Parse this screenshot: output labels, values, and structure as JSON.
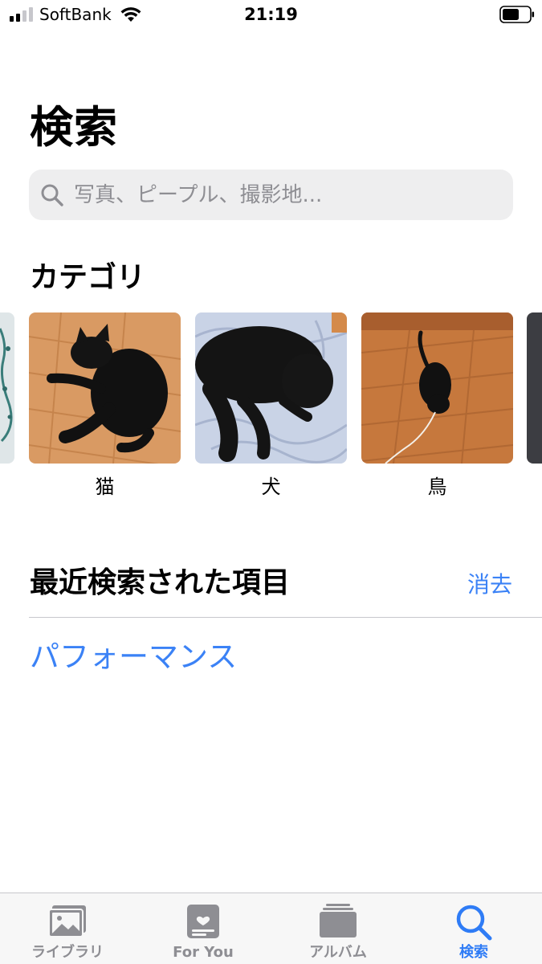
{
  "status_bar": {
    "carrier": "SoftBank",
    "time": "21:19",
    "signal_bars": 4,
    "signal_bars_filled": 2
  },
  "page": {
    "title": "検索",
    "search": {
      "placeholder": "写真、ピープル、撮影地..."
    }
  },
  "categories": {
    "title": "カテゴリ",
    "items": [
      {
        "label": "猫",
        "image": "black cat lying on wooden floor"
      },
      {
        "label": "犬",
        "image": "black cat curled on blue-white patterned blanket"
      },
      {
        "label": "鳥",
        "image": "small black cat on wooden floor with white cable"
      }
    ]
  },
  "recent": {
    "title": "最近検索された項目",
    "clear_label": "消去",
    "items": [
      "パフォーマンス"
    ]
  },
  "tab_bar": {
    "tabs": [
      {
        "label": "ライブラリ",
        "icon": "photos-library-icon",
        "active": false
      },
      {
        "label": "For You",
        "icon": "for-you-icon",
        "active": false
      },
      {
        "label": "アルバム",
        "icon": "albums-icon",
        "active": false
      },
      {
        "label": "検索",
        "icon": "search-icon",
        "active": true
      }
    ]
  },
  "colors": {
    "accent": "#2f7cf6",
    "link": "#3b82f6",
    "search_field_bg": "#eeeeef",
    "placeholder": "#8e8e93",
    "tab_bar_bg": "#f7f7f7",
    "inactive_tab": "#8e8e93"
  }
}
